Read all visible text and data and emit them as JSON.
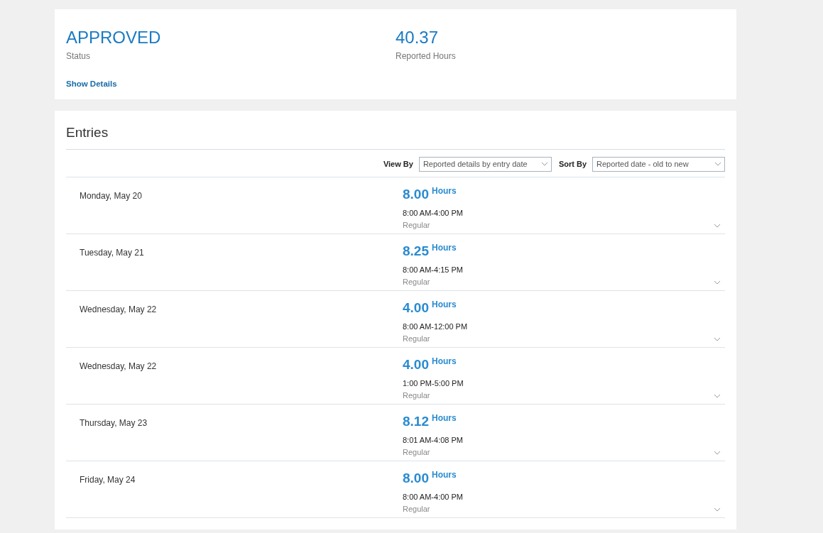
{
  "summary": {
    "status": "APPROVED",
    "status_label": "Status",
    "hours": "40.37",
    "hours_label": "Reported Hours",
    "details_link": "Show Details"
  },
  "entries_section": {
    "title": "Entries",
    "filters": [
      {
        "label": "View By",
        "value": "Reported details by entry date"
      },
      {
        "label": "Sort By",
        "value": "Reported date - old to new"
      }
    ],
    "entries": [
      {
        "date": "Monday, May 20",
        "hours": "8.00",
        "unit": "Hours",
        "time": "8:00 AM-4:00 PM",
        "type": "Regular"
      },
      {
        "date": "Tuesday, May 21",
        "hours": "8.25",
        "unit": "Hours",
        "time": "8:00 AM-4:15 PM",
        "type": "Regular"
      },
      {
        "date": "Wednesday, May 22",
        "hours": "4.00",
        "unit": "Hours",
        "time": "8:00 AM-12:00 PM",
        "type": "Regular"
      },
      {
        "date": "Wednesday, May 22",
        "hours": "4.00",
        "unit": "Hours",
        "time": "1:00 PM-5:00 PM",
        "type": "Regular"
      },
      {
        "date": "Thursday, May 23",
        "hours": "8.12",
        "unit": "Hours",
        "time": "8:01 AM-4:08 PM",
        "type": "Regular"
      },
      {
        "date": "Friday, May 24",
        "hours": "8.00",
        "unit": "Hours",
        "time": "8:00 AM-4:00 PM",
        "type": "Regular"
      }
    ]
  }
}
